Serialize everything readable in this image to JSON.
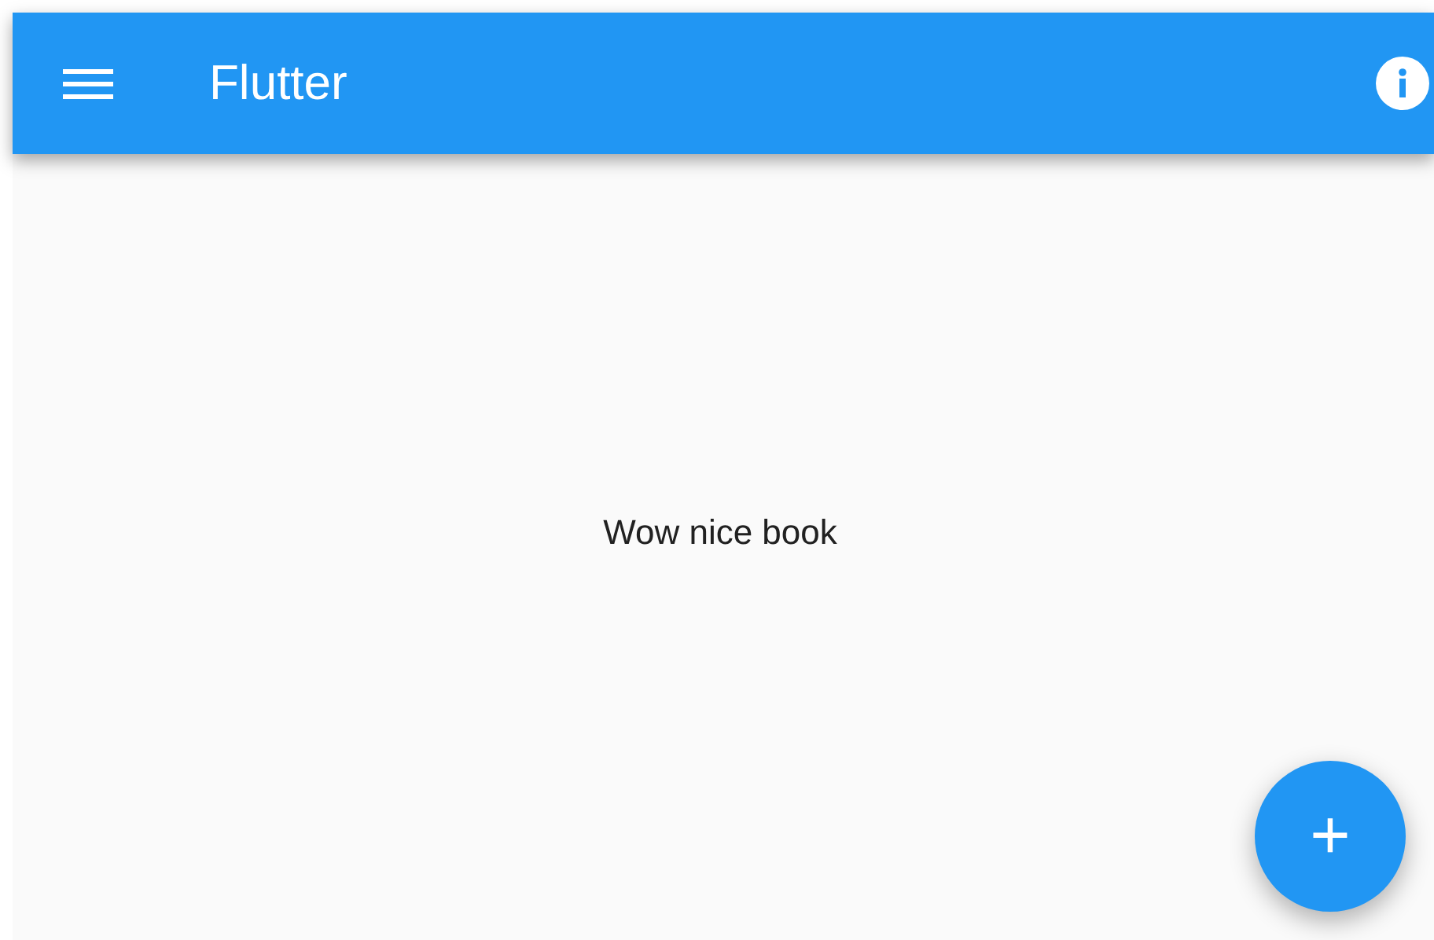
{
  "app_bar": {
    "title": "Flutter"
  },
  "body": {
    "text": "Wow nice book"
  },
  "fab": {
    "label": "+"
  }
}
